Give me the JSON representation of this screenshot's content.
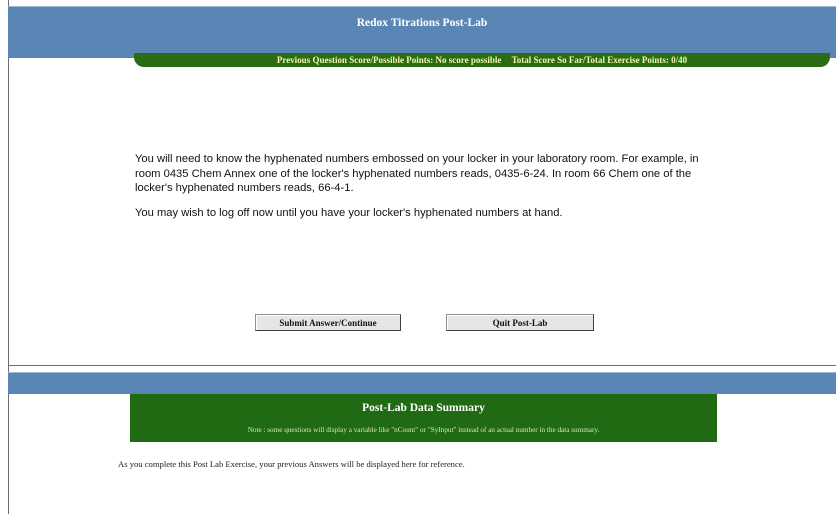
{
  "header": {
    "title": "Redox Titrations Post-Lab",
    "previous_score_label": "Previous Question Score/Possible Points: No score possible",
    "total_score_label": "Total Score So Far/Total Exercise Points: 0/40"
  },
  "colors": {
    "header_blue": "#5a86b5",
    "score_green": "#2b6b16",
    "summary_green": "#1f6a13",
    "score_text": "#f1f8a8"
  },
  "message": {
    "paragraph1": "You will need to know the hyphenated numbers embossed on your locker in your laboratory room. For example, in room 0435 Chem Annex one of the locker's hyphenated numbers reads, 0435-6-24. In room 66 Chem one of the locker's hyphenated numbers reads, 66-4-1.",
    "paragraph2": "You may wish to log off now until you have your locker's hyphenated numbers at hand."
  },
  "buttons": {
    "submit_label": "Submit Answer/Continue",
    "quit_label": "Quit Post-Lab"
  },
  "summary": {
    "title": "Post-Lab Data Summary",
    "note": "Note : some questions will display a variable like \"nCount\" or \"SyInput\" instead of an actual number in the data summary.",
    "footer": "As you complete this Post Lab Exercise, your previous Answers will be displayed here for reference."
  }
}
